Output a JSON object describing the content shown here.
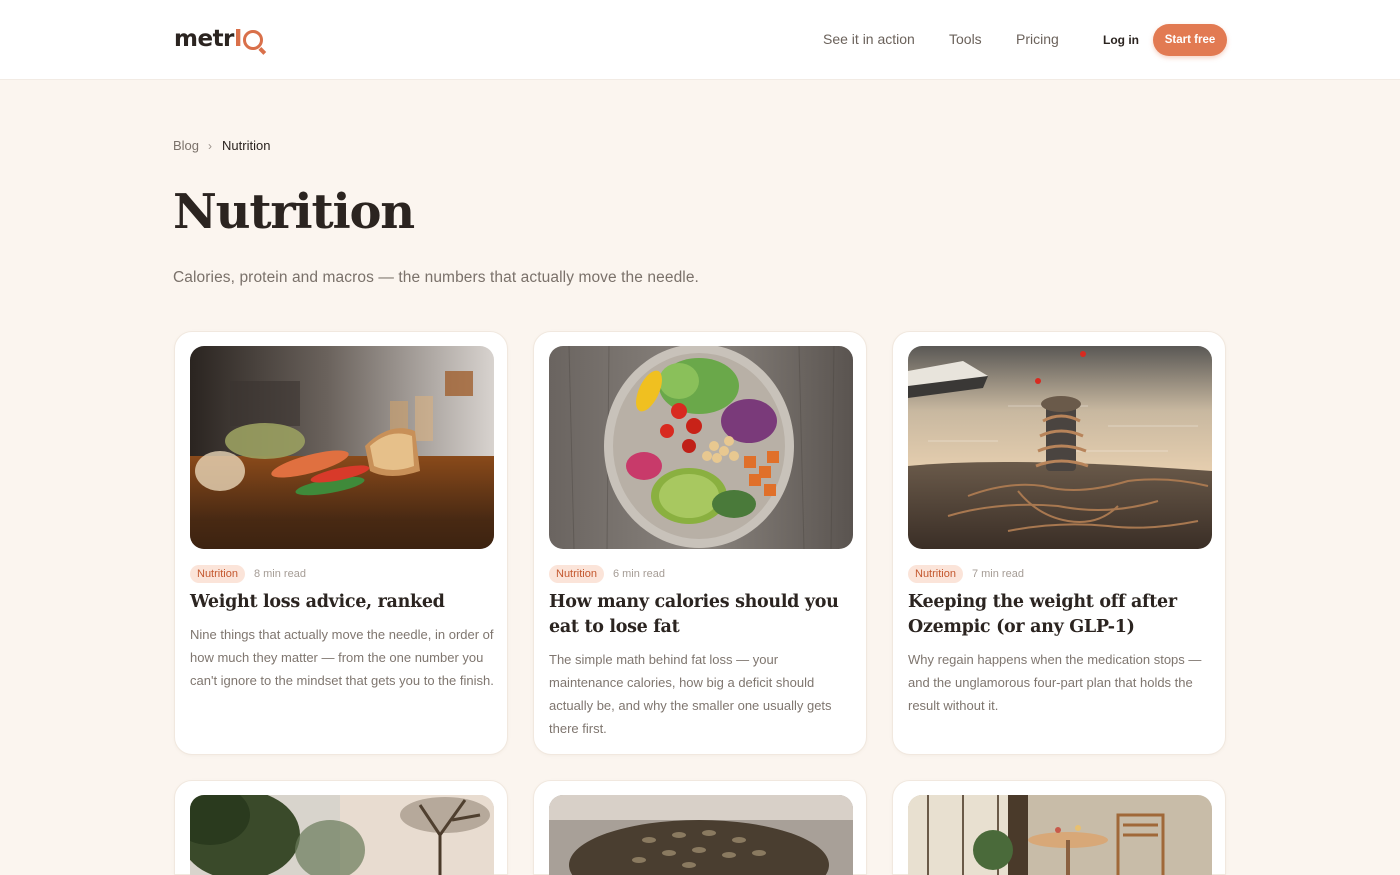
{
  "brand": {
    "name_prefix": "metr",
    "name_suffix": "I"
  },
  "nav": {
    "see_it": "See it in action",
    "tools": "Tools",
    "pricing": "Pricing",
    "login": "Log in",
    "start": "Start free"
  },
  "breadcrumb": {
    "root": "Blog",
    "separator": "›",
    "current": "Nutrition"
  },
  "page": {
    "title": "Nutrition",
    "subtitle": "Calories, protein and macros — the numbers that actually move the needle."
  },
  "colors": {
    "accent": "#e27a52",
    "tag_bg": "#fbe4d9",
    "tag_text": "#c4582f",
    "page_bg": "#fbf5ef"
  },
  "cards": [
    {
      "tag": "Nutrition",
      "read_time": "8 min read",
      "title": "Weight loss advice, ranked",
      "description": "Nine things that actually move the needle, in order of how much they matter — from the one number you can't ignore to the mindset that gets you to the finish.",
      "image": "kitchen-counter-vegetables-photo"
    },
    {
      "tag": "Nutrition",
      "read_time": "6 min read",
      "title": "How many calories should you eat to lose fat",
      "description": "The simple math behind fat loss — your maintenance calories, how big a deficit should actually be, and why the smaller one usually gets there first.",
      "image": "salad-bowl-photo"
    },
    {
      "tag": "Nutrition",
      "read_time": "7 min read",
      "title": "Keeping the weight off after Ozempic (or any GLP-1)",
      "description": "Why regain happens when the medication stops — and the unglamorous four-part plan that holds the result without it.",
      "image": "rope-bollard-shoreline-photo"
    },
    {
      "image": "forest-trees-photo"
    },
    {
      "image": "seeds-closeup-photo"
    },
    {
      "image": "dining-room-photo"
    }
  ]
}
